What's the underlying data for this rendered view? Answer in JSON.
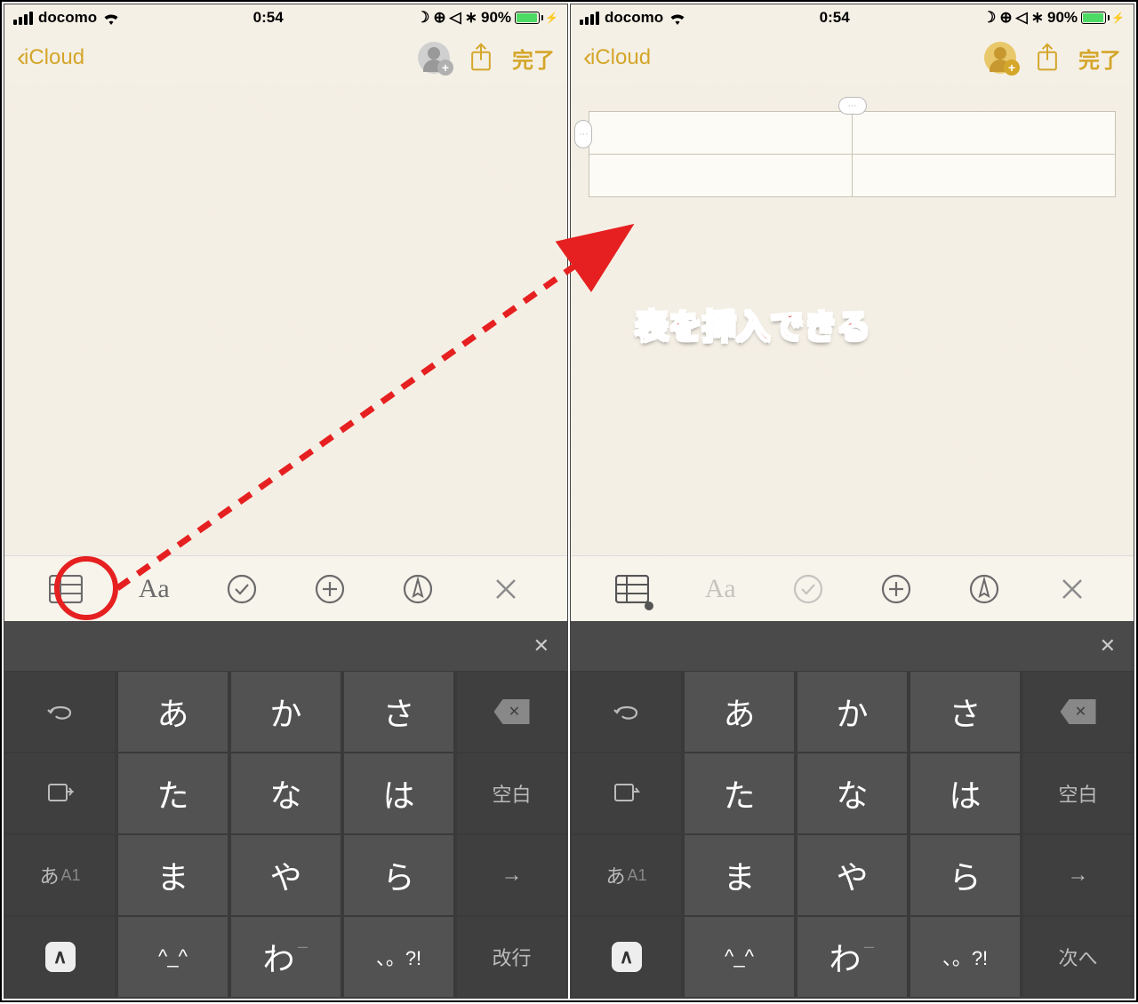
{
  "status": {
    "carrier": "docomo",
    "time": "0:54",
    "battery_pct": "90%"
  },
  "nav": {
    "back_label": "iCloud",
    "done_label": "完了"
  },
  "callout": "表を挿入できる",
  "toolbar": {
    "icons": [
      "table",
      "Aa",
      "check",
      "plus",
      "pen",
      "close"
    ]
  },
  "keyboard": {
    "rows": [
      [
        "undo",
        "あ",
        "か",
        "さ",
        "backspace"
      ],
      [
        "next-kb",
        "た",
        "な",
        "は",
        "空白"
      ],
      [
        "mode",
        "ま",
        "や",
        "ら",
        "→"
      ],
      [
        "globe",
        "^_^",
        "わ",
        "、。?!",
        "改行"
      ]
    ],
    "mode_label_main": "あ",
    "mode_label_sub": "A1",
    "wa_sub": "ー",
    "return_label_right": "次へ"
  }
}
